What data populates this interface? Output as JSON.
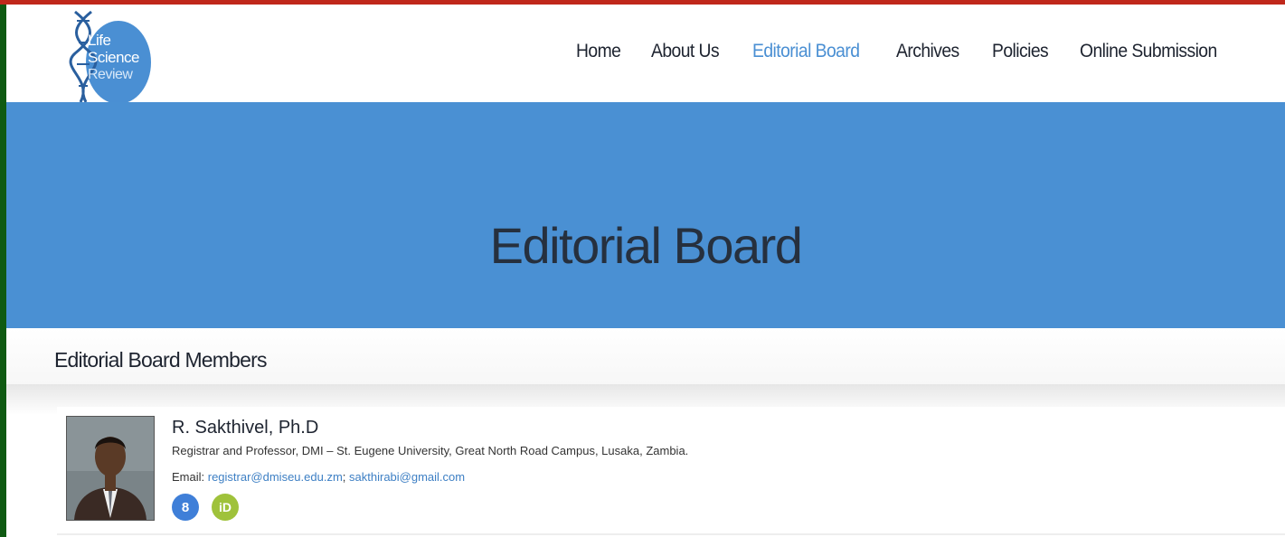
{
  "brand": {
    "logo_lines": [
      "Life",
      "Science",
      "Review"
    ],
    "colors": {
      "accent": "#4a8fd3",
      "hero": "#4a90d3",
      "text": "#1e2430",
      "link": "#3d7fc4"
    }
  },
  "nav": {
    "items": [
      {
        "label": "Home",
        "active": false
      },
      {
        "label": "About Us",
        "active": false
      },
      {
        "label": "Editorial Board",
        "active": true
      },
      {
        "label": "Archives",
        "active": false
      },
      {
        "label": "Policies",
        "active": false
      },
      {
        "label": "Online Submission",
        "active": false
      }
    ]
  },
  "hero": {
    "title": "Editorial Board"
  },
  "section": {
    "title": "Editorial Board Members"
  },
  "member": {
    "name": "R. Sakthivel, Ph.D",
    "role": "Registrar and Professor, DMI – St. Eugene University, Great North Road Campus, Lusaka, Zambia.",
    "email_label": "Email:",
    "email_1": "registrar@dmiseu.edu.zm",
    "email_sep": ";",
    "email_2": "sakthirabi@gmail.com",
    "icons": [
      {
        "name": "google-scholar-icon",
        "glyph": "8"
      },
      {
        "name": "orcid-icon",
        "glyph": "iD"
      }
    ]
  }
}
